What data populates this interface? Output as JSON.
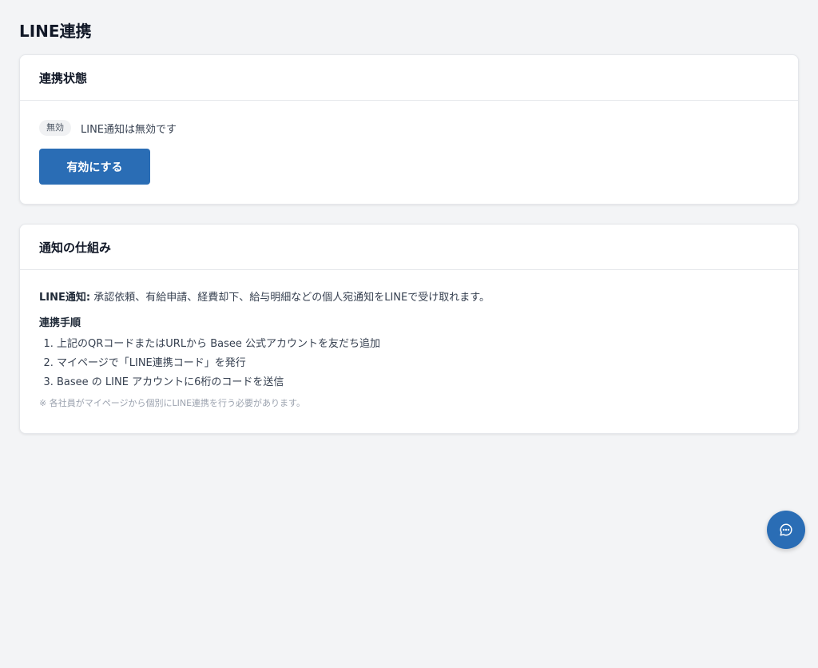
{
  "page": {
    "title": "LINE連携"
  },
  "status_card": {
    "title": "連携状態",
    "badge": "無効",
    "status_text": "LINE通知は無効です",
    "enable_button_label": "有効にする"
  },
  "howto_card": {
    "title": "通知の仕組み",
    "desc_label": "LINE通知:",
    "desc_text": " 承認依頼、有給申請、経費却下、給与明細などの個人宛通知をLINEで受け取れます。",
    "steps_title": "連携手順",
    "steps": [
      "上記のQRコードまたはURLから Basee 公式アカウントを友だち追加",
      "マイページで「LINE連携コード」を発行",
      "Basee の LINE アカウントに6桁のコードを送信"
    ],
    "note": "※ 各社員がマイページから個別にLINE連携を行う必要があります。"
  },
  "chat_button": {
    "icon": "chat-bubble-icon"
  },
  "colors": {
    "accent": "#2a6db5",
    "background": "#f3f4f6"
  }
}
